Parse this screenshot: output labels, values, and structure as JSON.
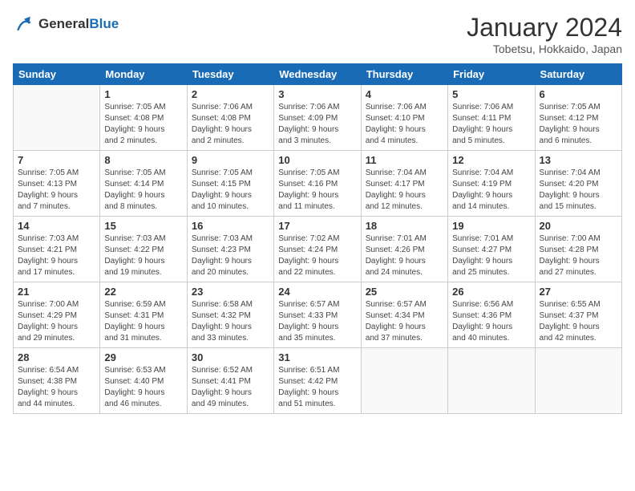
{
  "header": {
    "logo_line1": "General",
    "logo_line2": "Blue",
    "title": "January 2024",
    "subtitle": "Tobetsu, Hokkaido, Japan"
  },
  "days_of_week": [
    "Sunday",
    "Monday",
    "Tuesday",
    "Wednesday",
    "Thursday",
    "Friday",
    "Saturday"
  ],
  "weeks": [
    [
      {
        "day": "",
        "info": ""
      },
      {
        "day": "1",
        "info": "Sunrise: 7:05 AM\nSunset: 4:08 PM\nDaylight: 9 hours\nand 2 minutes."
      },
      {
        "day": "2",
        "info": "Sunrise: 7:06 AM\nSunset: 4:08 PM\nDaylight: 9 hours\nand 2 minutes."
      },
      {
        "day": "3",
        "info": "Sunrise: 7:06 AM\nSunset: 4:09 PM\nDaylight: 9 hours\nand 3 minutes."
      },
      {
        "day": "4",
        "info": "Sunrise: 7:06 AM\nSunset: 4:10 PM\nDaylight: 9 hours\nand 4 minutes."
      },
      {
        "day": "5",
        "info": "Sunrise: 7:06 AM\nSunset: 4:11 PM\nDaylight: 9 hours\nand 5 minutes."
      },
      {
        "day": "6",
        "info": "Sunrise: 7:05 AM\nSunset: 4:12 PM\nDaylight: 9 hours\nand 6 minutes."
      }
    ],
    [
      {
        "day": "7",
        "info": "Sunrise: 7:05 AM\nSunset: 4:13 PM\nDaylight: 9 hours\nand 7 minutes."
      },
      {
        "day": "8",
        "info": "Sunrise: 7:05 AM\nSunset: 4:14 PM\nDaylight: 9 hours\nand 8 minutes."
      },
      {
        "day": "9",
        "info": "Sunrise: 7:05 AM\nSunset: 4:15 PM\nDaylight: 9 hours\nand 10 minutes."
      },
      {
        "day": "10",
        "info": "Sunrise: 7:05 AM\nSunset: 4:16 PM\nDaylight: 9 hours\nand 11 minutes."
      },
      {
        "day": "11",
        "info": "Sunrise: 7:04 AM\nSunset: 4:17 PM\nDaylight: 9 hours\nand 12 minutes."
      },
      {
        "day": "12",
        "info": "Sunrise: 7:04 AM\nSunset: 4:19 PM\nDaylight: 9 hours\nand 14 minutes."
      },
      {
        "day": "13",
        "info": "Sunrise: 7:04 AM\nSunset: 4:20 PM\nDaylight: 9 hours\nand 15 minutes."
      }
    ],
    [
      {
        "day": "14",
        "info": "Sunrise: 7:03 AM\nSunset: 4:21 PM\nDaylight: 9 hours\nand 17 minutes."
      },
      {
        "day": "15",
        "info": "Sunrise: 7:03 AM\nSunset: 4:22 PM\nDaylight: 9 hours\nand 19 minutes."
      },
      {
        "day": "16",
        "info": "Sunrise: 7:03 AM\nSunset: 4:23 PM\nDaylight: 9 hours\nand 20 minutes."
      },
      {
        "day": "17",
        "info": "Sunrise: 7:02 AM\nSunset: 4:24 PM\nDaylight: 9 hours\nand 22 minutes."
      },
      {
        "day": "18",
        "info": "Sunrise: 7:01 AM\nSunset: 4:26 PM\nDaylight: 9 hours\nand 24 minutes."
      },
      {
        "day": "19",
        "info": "Sunrise: 7:01 AM\nSunset: 4:27 PM\nDaylight: 9 hours\nand 25 minutes."
      },
      {
        "day": "20",
        "info": "Sunrise: 7:00 AM\nSunset: 4:28 PM\nDaylight: 9 hours\nand 27 minutes."
      }
    ],
    [
      {
        "day": "21",
        "info": "Sunrise: 7:00 AM\nSunset: 4:29 PM\nDaylight: 9 hours\nand 29 minutes."
      },
      {
        "day": "22",
        "info": "Sunrise: 6:59 AM\nSunset: 4:31 PM\nDaylight: 9 hours\nand 31 minutes."
      },
      {
        "day": "23",
        "info": "Sunrise: 6:58 AM\nSunset: 4:32 PM\nDaylight: 9 hours\nand 33 minutes."
      },
      {
        "day": "24",
        "info": "Sunrise: 6:57 AM\nSunset: 4:33 PM\nDaylight: 9 hours\nand 35 minutes."
      },
      {
        "day": "25",
        "info": "Sunrise: 6:57 AM\nSunset: 4:34 PM\nDaylight: 9 hours\nand 37 minutes."
      },
      {
        "day": "26",
        "info": "Sunrise: 6:56 AM\nSunset: 4:36 PM\nDaylight: 9 hours\nand 40 minutes."
      },
      {
        "day": "27",
        "info": "Sunrise: 6:55 AM\nSunset: 4:37 PM\nDaylight: 9 hours\nand 42 minutes."
      }
    ],
    [
      {
        "day": "28",
        "info": "Sunrise: 6:54 AM\nSunset: 4:38 PM\nDaylight: 9 hours\nand 44 minutes."
      },
      {
        "day": "29",
        "info": "Sunrise: 6:53 AM\nSunset: 4:40 PM\nDaylight: 9 hours\nand 46 minutes."
      },
      {
        "day": "30",
        "info": "Sunrise: 6:52 AM\nSunset: 4:41 PM\nDaylight: 9 hours\nand 49 minutes."
      },
      {
        "day": "31",
        "info": "Sunrise: 6:51 AM\nSunset: 4:42 PM\nDaylight: 9 hours\nand 51 minutes."
      },
      {
        "day": "",
        "info": ""
      },
      {
        "day": "",
        "info": ""
      },
      {
        "day": "",
        "info": ""
      }
    ]
  ]
}
